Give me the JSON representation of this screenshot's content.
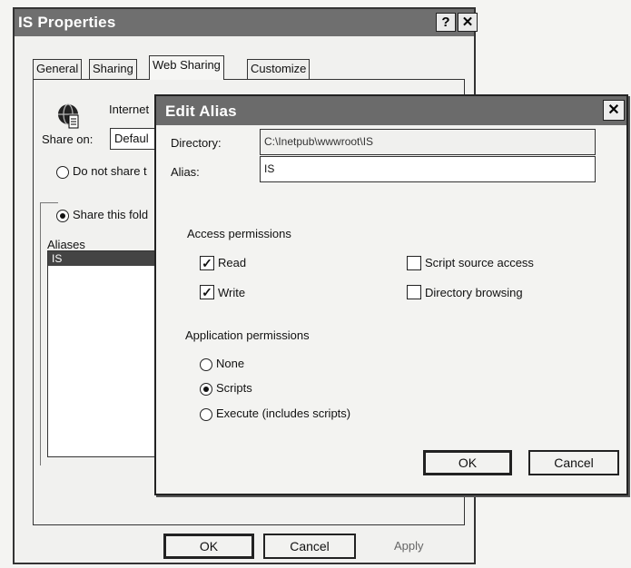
{
  "back": {
    "title": "IS Properties",
    "help_glyph": "?",
    "close_glyph": "✕",
    "tabs": [
      {
        "label": "General"
      },
      {
        "label": "Sharing"
      },
      {
        "label": "Web Sharing"
      },
      {
        "label": "Customize"
      }
    ],
    "internet_label": "Internet",
    "share_on_label": "Share on:",
    "share_on_value": "Defaul",
    "do_not_share_label": "Do not share t",
    "share_this_label": "Share this fold",
    "aliases_label": "Aliases",
    "aliases": [
      "IS"
    ],
    "ok_label": "OK",
    "cancel_label": "Cancel",
    "apply_label": "Apply"
  },
  "front": {
    "title": "Edit Alias",
    "close_glyph": "✕",
    "directory_label": "Directory:",
    "directory_value": "C:\\Inetpub\\wwwroot\\IS",
    "alias_label": "Alias:",
    "alias_value": "IS",
    "access_label": "Access permissions",
    "read_label": "Read",
    "write_label": "Write",
    "script_source_label": "Script source access",
    "dir_browsing_label": "Directory browsing",
    "app_perm_label": "Application permissions",
    "none_label": "None",
    "scripts_label": "Scripts",
    "execute_label": "Execute (includes scripts)",
    "ok_label": "OK",
    "cancel_label": "Cancel",
    "check_glyph": "✓"
  }
}
